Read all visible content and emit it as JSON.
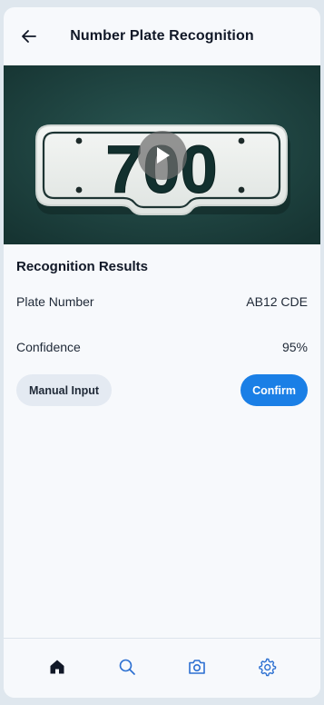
{
  "header": {
    "title": "Number Plate Recognition",
    "back_icon": "arrow-left-icon"
  },
  "media": {
    "plate_text": "700",
    "play_icon": "play-icon"
  },
  "results": {
    "title": "Recognition Results",
    "plate_number_label": "Plate Number",
    "plate_number_value": "AB12 CDE",
    "confidence_label": "Confidence",
    "confidence_value": "95%"
  },
  "actions": {
    "manual_input_label": "Manual Input",
    "confirm_label": "Confirm"
  },
  "tabbar": {
    "items": [
      {
        "icon": "home-icon",
        "active": true
      },
      {
        "icon": "search-icon",
        "active": false
      },
      {
        "icon": "camera-icon",
        "active": false
      },
      {
        "icon": "gear-icon",
        "active": false
      }
    ]
  },
  "colors": {
    "accent": "#1a7fe6",
    "background": "#f7f9fc",
    "secondary_button": "#e4eaf2",
    "tab_icon": "#2b6fd1",
    "media_bg": "#1f4643"
  }
}
